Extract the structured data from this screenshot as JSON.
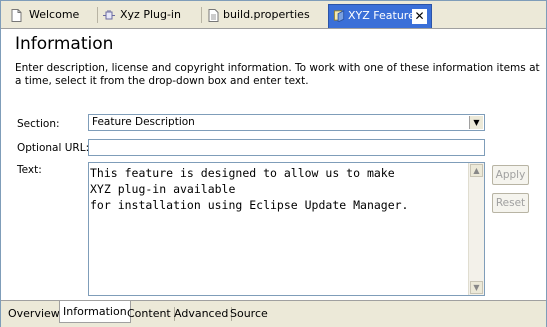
{
  "tabs": [
    {
      "label": "Welcome",
      "icon": "document-icon"
    },
    {
      "label": "Xyz Plug-in",
      "icon": "plugin-icon"
    },
    {
      "label": "build.properties",
      "icon": "properties-file-icon"
    },
    {
      "label": "XYZ Feature",
      "icon": "feature-icon",
      "active": true
    }
  ],
  "close_glyph": "✕",
  "section": {
    "title": "Information",
    "description": "Enter description, license and copyright information. To work with one of these information items at a time, select it from the drop-down box and enter text."
  },
  "form": {
    "section_label": "Section:",
    "section_value": "Feature Description",
    "optional_url_label": "Optional URL:",
    "optional_url_value": "",
    "text_label": "Text:",
    "text_value": "This feature is designed to allow us to make\nXYZ plug-in available\nfor installation using Eclipse Update Manager."
  },
  "buttons": {
    "apply": "Apply",
    "reset": "Reset"
  },
  "bottom_tabs": [
    {
      "label": "Overview"
    },
    {
      "label": "Information",
      "active": true
    },
    {
      "label": "Content"
    },
    {
      "label": "Advanced"
    },
    {
      "label": "Source"
    }
  ],
  "colors": {
    "active_tab": "#3a6fd8",
    "chrome": "#ece9d8",
    "border": "#7f9db9"
  }
}
